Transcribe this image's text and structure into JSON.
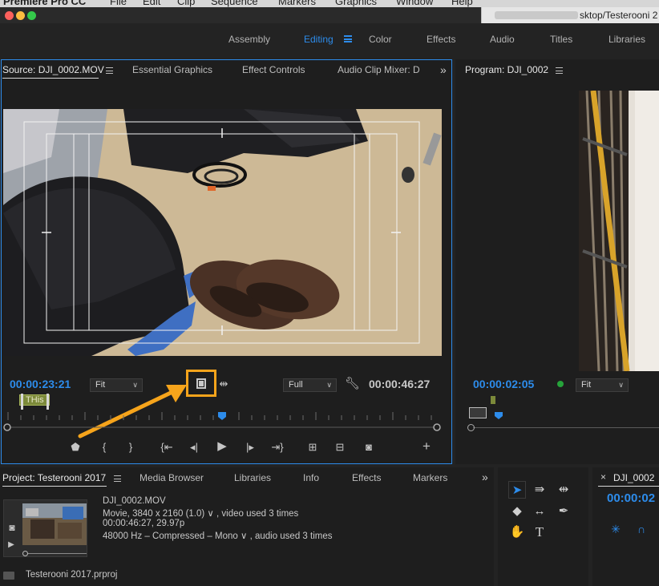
{
  "mac_menu": {
    "app_name": "Premiere Pro CC",
    "items": [
      "File",
      "Edit",
      "Clip",
      "Sequence",
      "Markers",
      "Graphics",
      "Window",
      "Help"
    ],
    "path_title": "sktop/Testerooni 2"
  },
  "workspaces": {
    "items": [
      "Assembly",
      "Editing",
      "Color",
      "Effects",
      "Audio",
      "Titles",
      "Libraries"
    ],
    "active": "Editing"
  },
  "source_panel": {
    "tabs": [
      "Source: DJI_0002.MOV",
      "Essential Graphics",
      "Effect Controls",
      "Audio Clip Mixer: D"
    ],
    "active_tab": "Source: DJI_0002.MOV",
    "overflow_glyph": "»",
    "timecode_in": "00:00:23:21",
    "fit_value": "Fit",
    "resolution_value": "Full",
    "timecode_duration": "00:00:46:27",
    "marker_label": "THis"
  },
  "program_panel": {
    "title": "Program: DJI_0002",
    "timecode": "00:00:02:05",
    "fit_value": "Fit"
  },
  "project_panel": {
    "tabs": [
      "Project: Testerooni 2017",
      "Media Browser",
      "Libraries",
      "Info",
      "Effects",
      "Markers"
    ],
    "overflow_glyph": "»",
    "clip_name": "DJI_0002.MOV",
    "line1": "Movie, 3840 x 2160 (1.0) ∨ , video used 3 times",
    "line2": "00:00:46:27, 29.97p",
    "line3": "48000 Hz – Compressed – Mono ∨ , audio used 3 times",
    "project_file": "Testerooni 2017.prproj"
  },
  "timeline_panel": {
    "tab": "DJI_0002",
    "timecode": "00:00:02"
  },
  "colors": {
    "accent": "#2d8ceb",
    "highlight": "#f6a41b",
    "panel_bg": "#1e1e1e",
    "marker_green": "#7c8a3a",
    "dot_green": "#26a33a"
  },
  "icons": {
    "export_frame": "export-frame-icon",
    "wrench": "wrench-icon",
    "camera": "camera-icon"
  }
}
